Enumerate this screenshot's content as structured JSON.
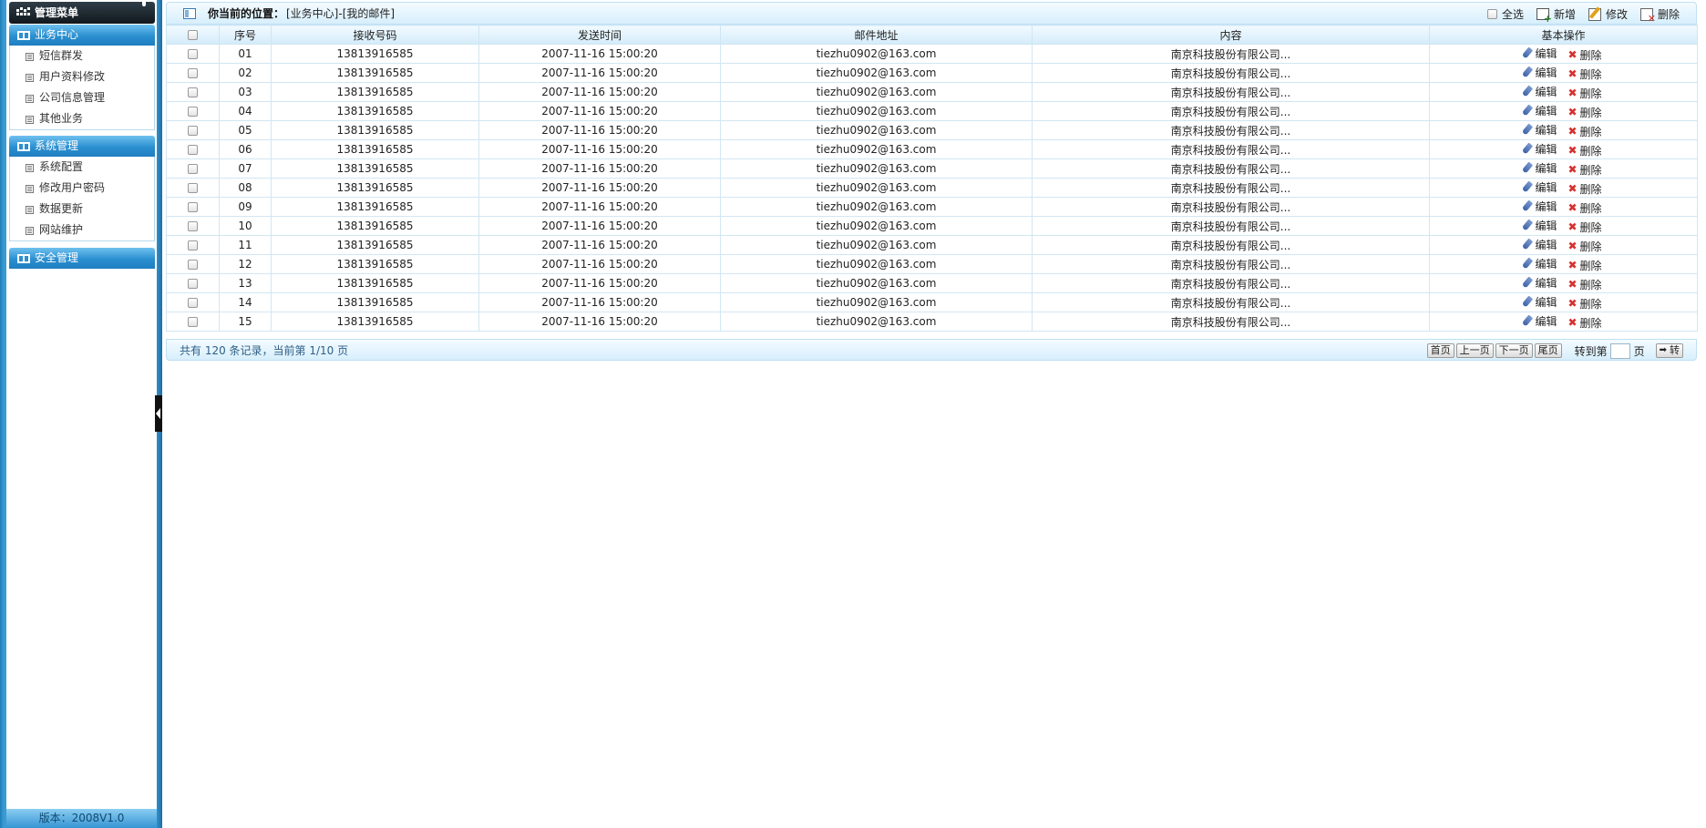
{
  "sidebar": {
    "title": "管理菜单",
    "groups": [
      {
        "label": "业务中心",
        "items": [
          "短信群发",
          "用户资料修改",
          "公司信息管理",
          "其他业务"
        ]
      },
      {
        "label": "系统管理",
        "items": [
          "系统配置",
          "修改用户密码",
          "数据更新",
          "网站维护"
        ]
      },
      {
        "label": "安全管理",
        "items": []
      }
    ],
    "version": "版本：2008V1.0"
  },
  "toolbar": {
    "position_label": "你当前的位置：",
    "position_path": "[业务中心]-[我的邮件]",
    "select_all": "全选",
    "add": "新增",
    "modify": "修改",
    "delete": "删除"
  },
  "table": {
    "headers": [
      "序号",
      "接收号码",
      "发送时间",
      "邮件地址",
      "内容",
      "基本操作"
    ],
    "rows": [
      [
        "01",
        "13813916585",
        "2007-11-16 15:00:20",
        "tiezhu0902@163.com",
        "南京科技股份有限公司..."
      ],
      [
        "02",
        "13813916585",
        "2007-11-16 15:00:20",
        "tiezhu0902@163.com",
        "南京科技股份有限公司..."
      ],
      [
        "03",
        "13813916585",
        "2007-11-16 15:00:20",
        "tiezhu0902@163.com",
        "南京科技股份有限公司..."
      ],
      [
        "04",
        "13813916585",
        "2007-11-16 15:00:20",
        "tiezhu0902@163.com",
        "南京科技股份有限公司..."
      ],
      [
        "05",
        "13813916585",
        "2007-11-16 15:00:20",
        "tiezhu0902@163.com",
        "南京科技股份有限公司..."
      ],
      [
        "06",
        "13813916585",
        "2007-11-16 15:00:20",
        "tiezhu0902@163.com",
        "南京科技股份有限公司..."
      ],
      [
        "07",
        "13813916585",
        "2007-11-16 15:00:20",
        "tiezhu0902@163.com",
        "南京科技股份有限公司..."
      ],
      [
        "08",
        "13813916585",
        "2007-11-16 15:00:20",
        "tiezhu0902@163.com",
        "南京科技股份有限公司..."
      ],
      [
        "09",
        "13813916585",
        "2007-11-16 15:00:20",
        "tiezhu0902@163.com",
        "南京科技股份有限公司..."
      ],
      [
        "10",
        "13813916585",
        "2007-11-16 15:00:20",
        "tiezhu0902@163.com",
        "南京科技股份有限公司..."
      ],
      [
        "11",
        "13813916585",
        "2007-11-16 15:00:20",
        "tiezhu0902@163.com",
        "南京科技股份有限公司..."
      ],
      [
        "12",
        "13813916585",
        "2007-11-16 15:00:20",
        "tiezhu0902@163.com",
        "南京科技股份有限公司..."
      ],
      [
        "13",
        "13813916585",
        "2007-11-16 15:00:20",
        "tiezhu0902@163.com",
        "南京科技股份有限公司..."
      ],
      [
        "14",
        "13813916585",
        "2007-11-16 15:00:20",
        "tiezhu0902@163.com",
        "南京科技股份有限公司..."
      ],
      [
        "15",
        "13813916585",
        "2007-11-16 15:00:20",
        "tiezhu0902@163.com",
        "南京科技股份有限公司..."
      ]
    ],
    "row_actions": {
      "edit": "编辑",
      "delete": "删除"
    }
  },
  "footer": {
    "record_info": "共有 120 条记录，当前第 1/10 页",
    "first": "首页",
    "prev": "上一页",
    "next": "下一页",
    "last": "尾页",
    "goto_label": "转到第",
    "goto_unit": "页",
    "go": "转"
  },
  "colors": {
    "accent": "#2b8fd0",
    "delete_icon": "#d5312e"
  }
}
